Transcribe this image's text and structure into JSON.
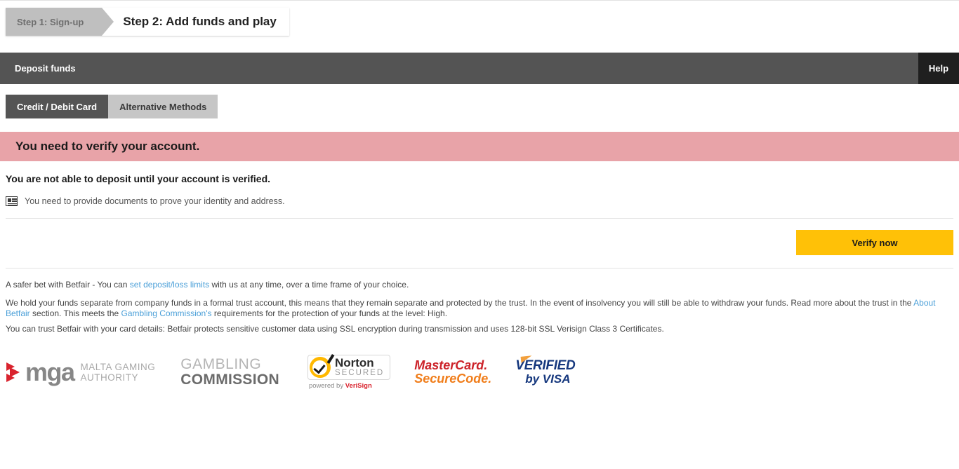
{
  "steps": {
    "completed_label": "Step 1: Sign-up",
    "active_label": "Step 2: Add funds and play"
  },
  "header": {
    "title": "Deposit funds",
    "help_label": "Help"
  },
  "tabs": [
    {
      "label": "Credit / Debit Card",
      "state": "active"
    },
    {
      "label": "Alternative Methods",
      "state": "inactive"
    }
  ],
  "alert": {
    "title": "You need to verify your account.",
    "background_color": "#e8a3a8"
  },
  "body": {
    "headline": "You are not able to deposit until your account is verified.",
    "document_note": "You need to provide documents to prove your identity and address.",
    "document_icon": "id-card-icon"
  },
  "cta": {
    "verify_label": "Verify now",
    "button_color": "#ffc107"
  },
  "legal": {
    "paragraph1_pre": "A safer bet with Betfair - You can ",
    "paragraph1_link": "set deposit/loss limits",
    "paragraph1_post": " with us at any time, over a time frame of your choice.",
    "paragraph2_pre": "We hold your funds separate from company funds in a formal trust account, this means that they remain separate and protected by the trust. In the event of insolvency you will still be able to withdraw your funds. Read more about the trust in the ",
    "paragraph2_link1": "About Betfair",
    "paragraph2_mid": " section. This meets the ",
    "paragraph2_link2": "Gambling Commission's",
    "paragraph2_post": " requirements for the protection of your funds at the level: High.",
    "paragraph3": "You can trust Betfair with your card details: Betfair protects sensitive customer data using SSL encryption during transmission and uses 128-bit SSL Verisign Class 3 Certificates.",
    "link_color": "#4a9fd8"
  },
  "logos": {
    "mga": {
      "word": "mga",
      "sub_line1": "MALTA GAMING",
      "sub_line2": "AUTHORITY",
      "accent_color": "#d9232e"
    },
    "gambling_commission": {
      "line1": "GAMBLING",
      "line2": "COMMISSION"
    },
    "norton": {
      "line1": "Norton",
      "line2": "SECURED",
      "trademark": "™",
      "footer_pre": "powered by ",
      "footer_brand": "VeriSign",
      "badge_color": "#ffb800"
    },
    "mastercard": {
      "line1": "MasterCard.",
      "line2": "SecureCode.",
      "color1": "#cc2229",
      "color2": "#f07d1a"
    },
    "visa": {
      "line1": "VERIFIED",
      "line2": "by VISA",
      "color": "#16387e"
    }
  }
}
